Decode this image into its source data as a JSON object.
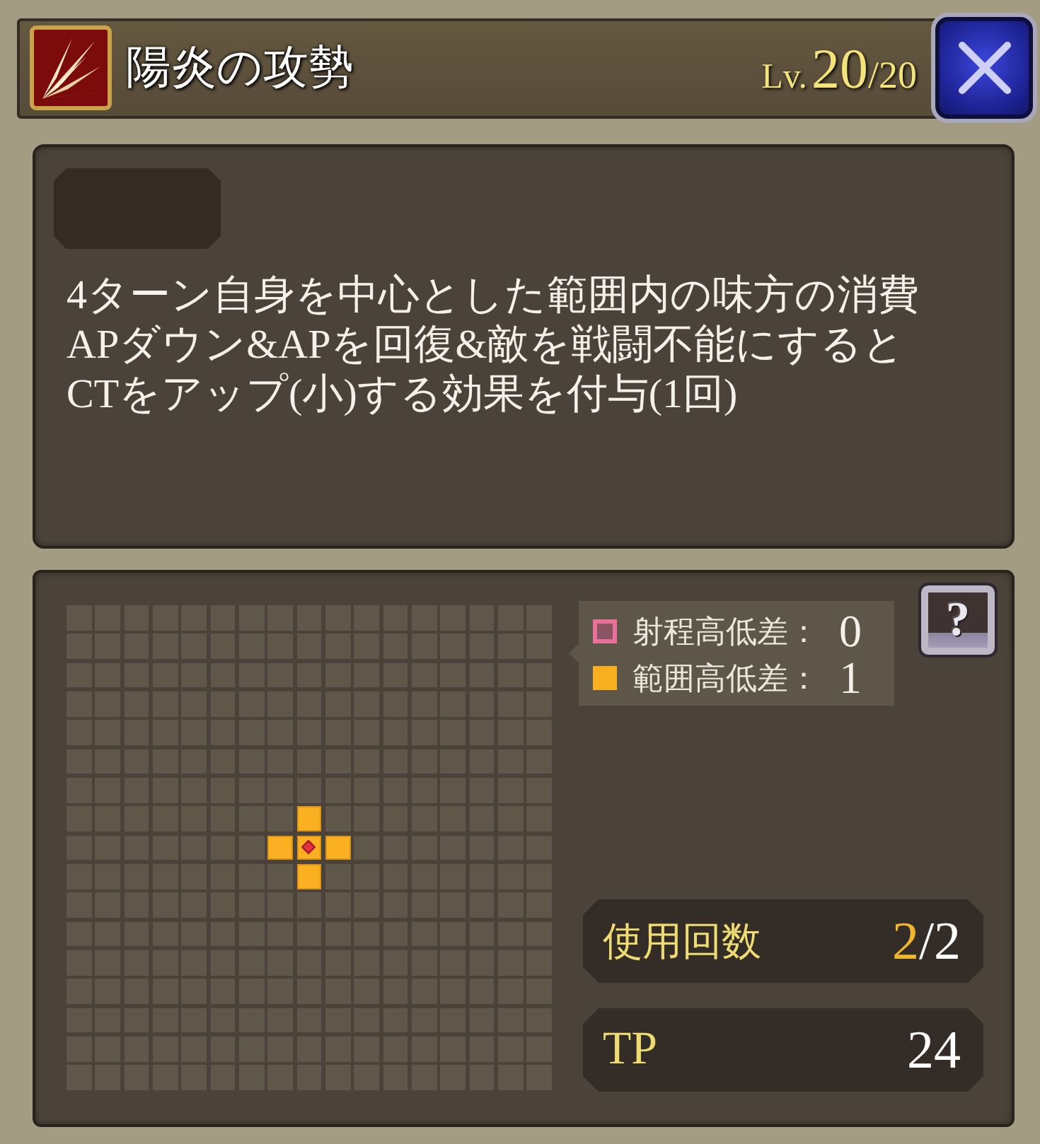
{
  "header": {
    "title": "陽炎の攻勢",
    "rank": {
      "prefix": "Lv.",
      "current": "20",
      "total": "/20"
    }
  },
  "description": {
    "lines": [
      "4ターン自身を中心とした範囲内の味方の消費",
      "APダウン&APを回復&敵を戦闘不能にすると",
      "CTをアップ(小)する効果を付与(1回)"
    ]
  },
  "range_grid": {
    "rows": [
      [
        {
          "kind": "empty"
        },
        {
          "kind": "empty"
        },
        {
          "kind": "empty"
        },
        {
          "kind": "empty"
        },
        {
          "kind": "empty"
        },
        {
          "kind": "empty"
        },
        {
          "kind": "empty"
        },
        {
          "kind": "empty"
        },
        {
          "kind": "empty"
        },
        {
          "kind": "empty"
        },
        {
          "kind": "empty"
        },
        {
          "kind": "empty"
        },
        {
          "kind": "empty"
        },
        {
          "kind": "empty"
        },
        {
          "kind": "empty"
        },
        {
          "kind": "empty"
        },
        {
          "kind": "empty"
        }
      ],
      [
        {
          "kind": "empty"
        },
        {
          "kind": "empty"
        },
        {
          "kind": "empty"
        },
        {
          "kind": "empty"
        },
        {
          "kind": "empty"
        },
        {
          "kind": "empty"
        },
        {
          "kind": "empty"
        },
        {
          "kind": "empty"
        },
        {
          "kind": "empty"
        },
        {
          "kind": "empty"
        },
        {
          "kind": "empty"
        },
        {
          "kind": "empty"
        },
        {
          "kind": "empty"
        },
        {
          "kind": "empty"
        },
        {
          "kind": "empty"
        },
        {
          "kind": "empty"
        },
        {
          "kind": "empty"
        }
      ],
      [
        {
          "kind": "empty"
        },
        {
          "kind": "empty"
        },
        {
          "kind": "empty"
        },
        {
          "kind": "empty"
        },
        {
          "kind": "empty"
        },
        {
          "kind": "empty"
        },
        {
          "kind": "empty"
        },
        {
          "kind": "empty"
        },
        {
          "kind": "empty"
        },
        {
          "kind": "empty"
        },
        {
          "kind": "empty"
        },
        {
          "kind": "empty"
        },
        {
          "kind": "empty"
        },
        {
          "kind": "empty"
        },
        {
          "kind": "empty"
        },
        {
          "kind": "empty"
        },
        {
          "kind": "empty"
        }
      ],
      [
        {
          "kind": "empty"
        },
        {
          "kind": "empty"
        },
        {
          "kind": "empty"
        },
        {
          "kind": "empty"
        },
        {
          "kind": "empty"
        },
        {
          "kind": "empty"
        },
        {
          "kind": "empty"
        },
        {
          "kind": "empty"
        },
        {
          "kind": "empty"
        },
        {
          "kind": "empty"
        },
        {
          "kind": "empty"
        },
        {
          "kind": "empty"
        },
        {
          "kind": "empty"
        },
        {
          "kind": "empty"
        },
        {
          "kind": "empty"
        },
        {
          "kind": "empty"
        },
        {
          "kind": "empty"
        }
      ],
      [
        {
          "kind": "empty"
        },
        {
          "kind": "empty"
        },
        {
          "kind": "empty"
        },
        {
          "kind": "empty"
        },
        {
          "kind": "empty"
        },
        {
          "kind": "empty"
        },
        {
          "kind": "empty"
        },
        {
          "kind": "empty"
        },
        {
          "kind": "empty"
        },
        {
          "kind": "empty"
        },
        {
          "kind": "empty"
        },
        {
          "kind": "empty"
        },
        {
          "kind": "empty"
        },
        {
          "kind": "empty"
        },
        {
          "kind": "empty"
        },
        {
          "kind": "empty"
        },
        {
          "kind": "empty"
        }
      ],
      [
        {
          "kind": "empty"
        },
        {
          "kind": "empty"
        },
        {
          "kind": "empty"
        },
        {
          "kind": "empty"
        },
        {
          "kind": "empty"
        },
        {
          "kind": "empty"
        },
        {
          "kind": "empty"
        },
        {
          "kind": "empty"
        },
        {
          "kind": "empty"
        },
        {
          "kind": "empty"
        },
        {
          "kind": "empty"
        },
        {
          "kind": "empty"
        },
        {
          "kind": "empty"
        },
        {
          "kind": "empty"
        },
        {
          "kind": "empty"
        },
        {
          "kind": "empty"
        },
        {
          "kind": "empty"
        }
      ],
      [
        {
          "kind": "empty"
        },
        {
          "kind": "empty"
        },
        {
          "kind": "empty"
        },
        {
          "kind": "empty"
        },
        {
          "kind": "empty"
        },
        {
          "kind": "empty"
        },
        {
          "kind": "empty"
        },
        {
          "kind": "empty"
        },
        {
          "kind": "empty"
        },
        {
          "kind": "empty"
        },
        {
          "kind": "empty"
        },
        {
          "kind": "empty"
        },
        {
          "kind": "empty"
        },
        {
          "kind": "empty"
        },
        {
          "kind": "empty"
        },
        {
          "kind": "empty"
        },
        {
          "kind": "empty"
        }
      ],
      [
        {
          "kind": "empty"
        },
        {
          "kind": "empty"
        },
        {
          "kind": "empty"
        },
        {
          "kind": "empty"
        },
        {
          "kind": "empty"
        },
        {
          "kind": "empty"
        },
        {
          "kind": "empty"
        },
        {
          "kind": "empty"
        },
        {
          "kind": "area"
        },
        {
          "kind": "empty"
        },
        {
          "kind": "empty"
        },
        {
          "kind": "empty"
        },
        {
          "kind": "empty"
        },
        {
          "kind": "empty"
        },
        {
          "kind": "empty"
        },
        {
          "kind": "empty"
        },
        {
          "kind": "empty"
        }
      ],
      [
        {
          "kind": "empty"
        },
        {
          "kind": "empty"
        },
        {
          "kind": "empty"
        },
        {
          "kind": "empty"
        },
        {
          "kind": "empty"
        },
        {
          "kind": "empty"
        },
        {
          "kind": "empty"
        },
        {
          "kind": "area"
        },
        {
          "kind": "center"
        },
        {
          "kind": "area"
        },
        {
          "kind": "empty"
        },
        {
          "kind": "empty"
        },
        {
          "kind": "empty"
        },
        {
          "kind": "empty"
        },
        {
          "kind": "empty"
        },
        {
          "kind": "empty"
        },
        {
          "kind": "empty"
        }
      ],
      [
        {
          "kind": "empty"
        },
        {
          "kind": "empty"
        },
        {
          "kind": "empty"
        },
        {
          "kind": "empty"
        },
        {
          "kind": "empty"
        },
        {
          "kind": "empty"
        },
        {
          "kind": "empty"
        },
        {
          "kind": "empty"
        },
        {
          "kind": "area"
        },
        {
          "kind": "empty"
        },
        {
          "kind": "empty"
        },
        {
          "kind": "empty"
        },
        {
          "kind": "empty"
        },
        {
          "kind": "empty"
        },
        {
          "kind": "empty"
        },
        {
          "kind": "empty"
        },
        {
          "kind": "empty"
        }
      ],
      [
        {
          "kind": "empty"
        },
        {
          "kind": "empty"
        },
        {
          "kind": "empty"
        },
        {
          "kind": "empty"
        },
        {
          "kind": "empty"
        },
        {
          "kind": "empty"
        },
        {
          "kind": "empty"
        },
        {
          "kind": "empty"
        },
        {
          "kind": "empty"
        },
        {
          "kind": "empty"
        },
        {
          "kind": "empty"
        },
        {
          "kind": "empty"
        },
        {
          "kind": "empty"
        },
        {
          "kind": "empty"
        },
        {
          "kind": "empty"
        },
        {
          "kind": "empty"
        },
        {
          "kind": "empty"
        }
      ],
      [
        {
          "kind": "empty"
        },
        {
          "kind": "empty"
        },
        {
          "kind": "empty"
        },
        {
          "kind": "empty"
        },
        {
          "kind": "empty"
        },
        {
          "kind": "empty"
        },
        {
          "kind": "empty"
        },
        {
          "kind": "empty"
        },
        {
          "kind": "empty"
        },
        {
          "kind": "empty"
        },
        {
          "kind": "empty"
        },
        {
          "kind": "empty"
        },
        {
          "kind": "empty"
        },
        {
          "kind": "empty"
        },
        {
          "kind": "empty"
        },
        {
          "kind": "empty"
        },
        {
          "kind": "empty"
        }
      ],
      [
        {
          "kind": "empty"
        },
        {
          "kind": "empty"
        },
        {
          "kind": "empty"
        },
        {
          "kind": "empty"
        },
        {
          "kind": "empty"
        },
        {
          "kind": "empty"
        },
        {
          "kind": "empty"
        },
        {
          "kind": "empty"
        },
        {
          "kind": "empty"
        },
        {
          "kind": "empty"
        },
        {
          "kind": "empty"
        },
        {
          "kind": "empty"
        },
        {
          "kind": "empty"
        },
        {
          "kind": "empty"
        },
        {
          "kind": "empty"
        },
        {
          "kind": "empty"
        },
        {
          "kind": "empty"
        }
      ],
      [
        {
          "kind": "empty"
        },
        {
          "kind": "empty"
        },
        {
          "kind": "empty"
        },
        {
          "kind": "empty"
        },
        {
          "kind": "empty"
        },
        {
          "kind": "empty"
        },
        {
          "kind": "empty"
        },
        {
          "kind": "empty"
        },
        {
          "kind": "empty"
        },
        {
          "kind": "empty"
        },
        {
          "kind": "empty"
        },
        {
          "kind": "empty"
        },
        {
          "kind": "empty"
        },
        {
          "kind": "empty"
        },
        {
          "kind": "empty"
        },
        {
          "kind": "empty"
        },
        {
          "kind": "empty"
        }
      ],
      [
        {
          "kind": "empty"
        },
        {
          "kind": "empty"
        },
        {
          "kind": "empty"
        },
        {
          "kind": "empty"
        },
        {
          "kind": "empty"
        },
        {
          "kind": "empty"
        },
        {
          "kind": "empty"
        },
        {
          "kind": "empty"
        },
        {
          "kind": "empty"
        },
        {
          "kind": "empty"
        },
        {
          "kind": "empty"
        },
        {
          "kind": "empty"
        },
        {
          "kind": "empty"
        },
        {
          "kind": "empty"
        },
        {
          "kind": "empty"
        },
        {
          "kind": "empty"
        },
        {
          "kind": "empty"
        }
      ],
      [
        {
          "kind": "empty"
        },
        {
          "kind": "empty"
        },
        {
          "kind": "empty"
        },
        {
          "kind": "empty"
        },
        {
          "kind": "empty"
        },
        {
          "kind": "empty"
        },
        {
          "kind": "empty"
        },
        {
          "kind": "empty"
        },
        {
          "kind": "empty"
        },
        {
          "kind": "empty"
        },
        {
          "kind": "empty"
        },
        {
          "kind": "empty"
        },
        {
          "kind": "empty"
        },
        {
          "kind": "empty"
        },
        {
          "kind": "empty"
        },
        {
          "kind": "empty"
        },
        {
          "kind": "empty"
        }
      ],
      [
        {
          "kind": "empty"
        },
        {
          "kind": "empty"
        },
        {
          "kind": "empty"
        },
        {
          "kind": "empty"
        },
        {
          "kind": "empty"
        },
        {
          "kind": "empty"
        },
        {
          "kind": "empty"
        },
        {
          "kind": "empty"
        },
        {
          "kind": "empty"
        },
        {
          "kind": "empty"
        },
        {
          "kind": "empty"
        },
        {
          "kind": "empty"
        },
        {
          "kind": "empty"
        },
        {
          "kind": "empty"
        },
        {
          "kind": "empty"
        },
        {
          "kind": "empty"
        },
        {
          "kind": "empty"
        }
      ]
    ]
  },
  "legend": {
    "items": [
      {
        "kind": "outline",
        "color": "#e8709a",
        "label": "射程高低差：",
        "value": "0"
      },
      {
        "kind": "filled",
        "color": "#f8b020",
        "label": "範囲高低差：",
        "value": "1"
      }
    ]
  },
  "help_button": {
    "label": "?"
  },
  "usage": {
    "label": "使用回数",
    "current": "2",
    "total": "/2"
  },
  "tp": {
    "label": "TP",
    "value": "24"
  }
}
